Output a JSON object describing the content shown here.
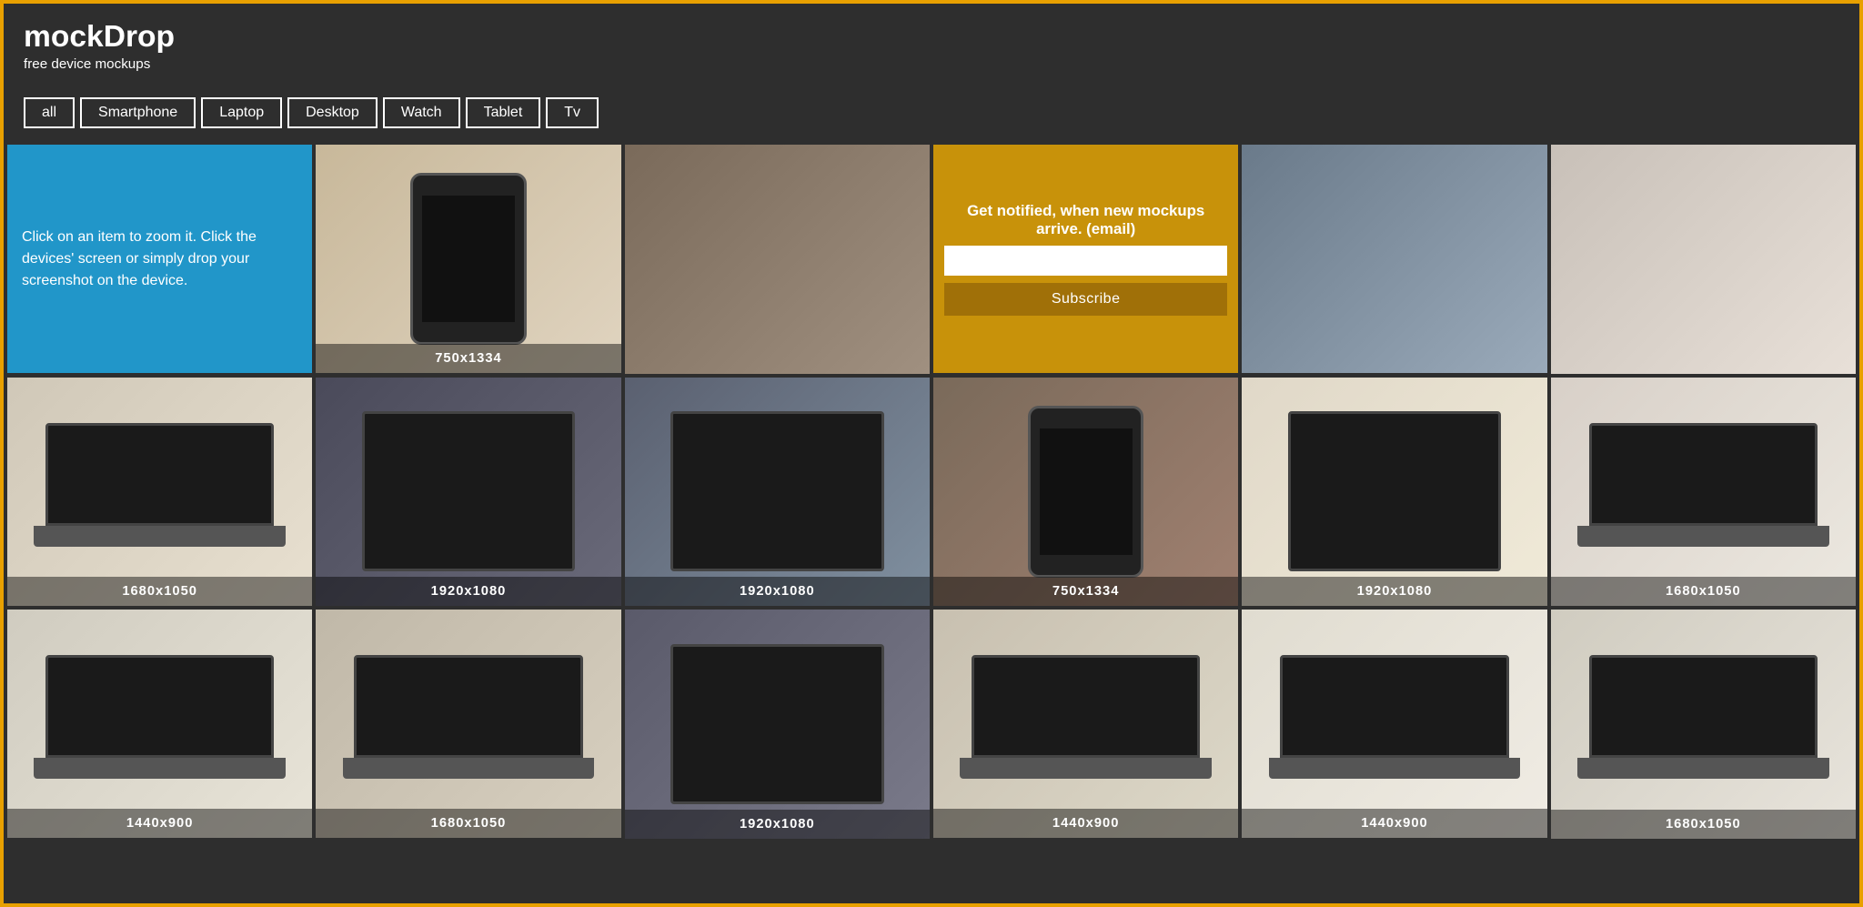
{
  "header": {
    "title": "mockDrop",
    "subtitle": "free device mockups"
  },
  "filters": {
    "items": [
      {
        "label": "all",
        "active": true
      },
      {
        "label": "Smartphone",
        "active": false
      },
      {
        "label": "Laptop",
        "active": false
      },
      {
        "label": "Desktop",
        "active": false
      },
      {
        "label": "Watch",
        "active": false
      },
      {
        "label": "Tablet",
        "active": false
      },
      {
        "label": "Tv",
        "active": false
      }
    ]
  },
  "info_box": {
    "text": "Click on an item to zoom it. Click the devices' screen or simply drop your screenshot on the device."
  },
  "subscribe": {
    "title": "Get notified, when new mockups arrive. (email)",
    "placeholder": "",
    "button_label": "Subscribe"
  },
  "grid": {
    "row1": [
      {
        "type": "info"
      },
      {
        "type": "image",
        "label": "750x1334",
        "class": "r1c2"
      },
      {
        "type": "image",
        "label": "",
        "class": "r1c3"
      },
      {
        "type": "subscribe"
      },
      {
        "type": "image",
        "label": "",
        "class": "r1c5"
      },
      {
        "type": "image",
        "label": "",
        "class": "r1c6"
      }
    ],
    "row2": [
      {
        "type": "image",
        "label": "1680x1050",
        "class": "r2c1"
      },
      {
        "type": "image",
        "label": "1920x1080",
        "class": "r2c2"
      },
      {
        "type": "image",
        "label": "1920x1080",
        "class": "r2c3"
      },
      {
        "type": "image",
        "label": "750x1334",
        "class": "r2c4"
      },
      {
        "type": "image",
        "label": "1920x1080",
        "class": "r2c5"
      },
      {
        "type": "image",
        "label": "1680x1050",
        "class": "r2c6"
      }
    ],
    "row3": [
      {
        "type": "image",
        "label": "1440x900",
        "class": "r3c1"
      },
      {
        "type": "image",
        "label": "1680x1050",
        "class": "r3c2"
      },
      {
        "type": "image",
        "label": "1920x1080",
        "class": "r3c3"
      },
      {
        "type": "image",
        "label": "1440x900",
        "class": "r3c4"
      },
      {
        "type": "image",
        "label": "1440x900",
        "class": "r3c5"
      },
      {
        "type": "image",
        "label": "1680x1050",
        "class": "r3c6"
      }
    ]
  }
}
